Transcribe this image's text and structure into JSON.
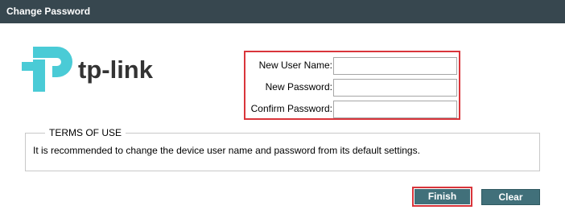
{
  "window": {
    "title": "Change Password"
  },
  "logo": {
    "brand_text": "tp-link",
    "brand_color": "#333333",
    "mark_color": "#4acbd6"
  },
  "form": {
    "new_user_name": {
      "label": "New User Name:",
      "value": ""
    },
    "new_password": {
      "label": "New Password:",
      "value": ""
    },
    "confirm_password": {
      "label": "Confirm Password:",
      "value": ""
    }
  },
  "terms": {
    "legend": "TERMS OF USE",
    "text": "It is recommended to change the device user name and password from its default settings."
  },
  "buttons": {
    "finish": "Finish",
    "clear": "Clear"
  },
  "colors": {
    "titlebar": "#37474f",
    "highlight": "#d9353b",
    "button": "#41707a"
  }
}
